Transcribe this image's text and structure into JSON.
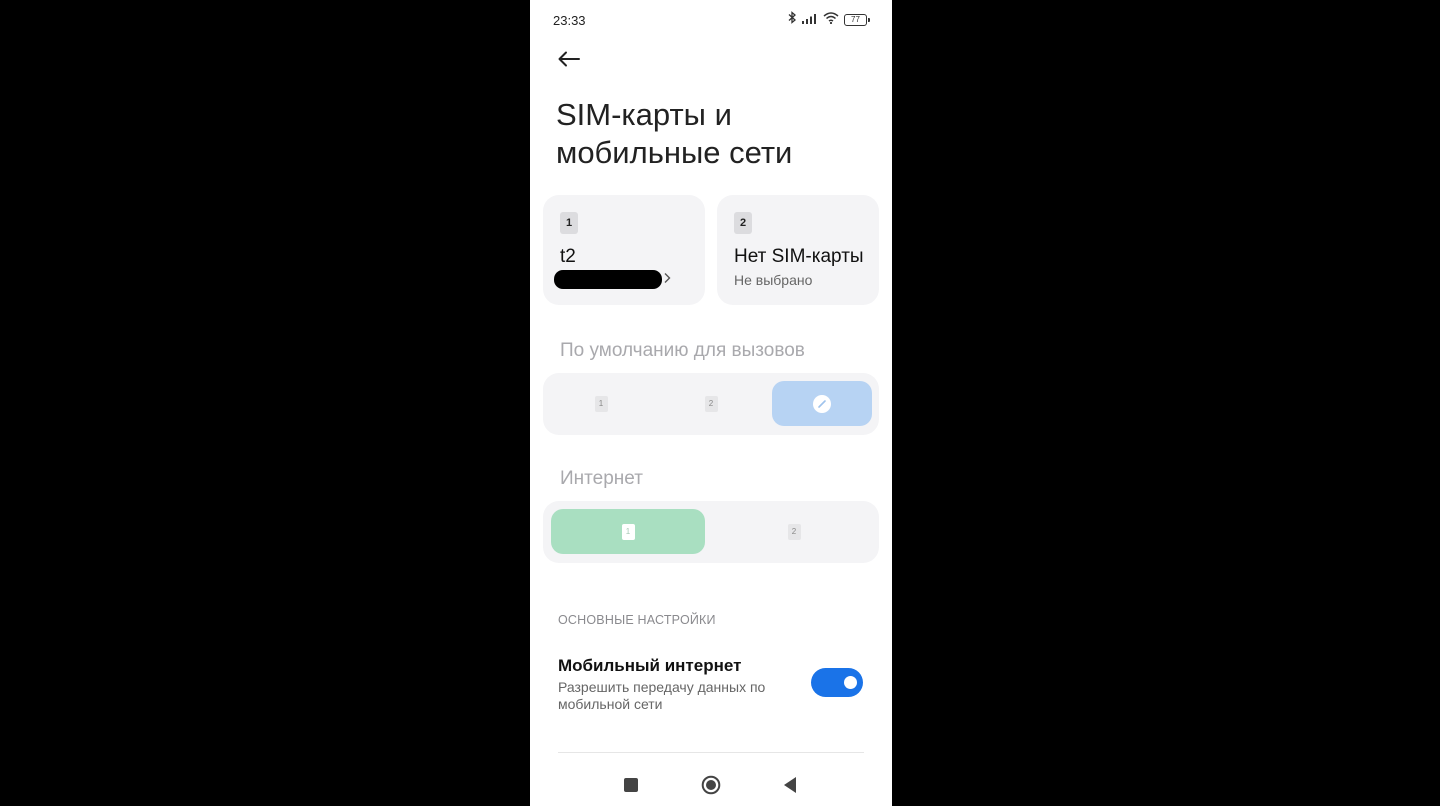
{
  "status_bar": {
    "time": "23:33",
    "battery": "77"
  },
  "header": {
    "title": "SIM-карты и мобильные сети"
  },
  "sim_cards": [
    {
      "slot": "1",
      "name": "t2",
      "subtitle": ""
    },
    {
      "slot": "2",
      "name": "Нет SIM-карты",
      "subtitle": "Не выбрано"
    }
  ],
  "calls": {
    "label": "По умолчанию для вызовов",
    "options": [
      {
        "slot": "1"
      },
      {
        "slot": "2"
      }
    ],
    "selected": "pencil-icon"
  },
  "internet": {
    "label": "Интернет",
    "options": [
      {
        "slot": "1"
      },
      {
        "slot": "2"
      }
    ],
    "selected_slot": "1"
  },
  "settings": {
    "group_header": "ОСНОВНЫЕ НАСТРОЙКИ",
    "mobile_data": {
      "title": "Мобильный интернет",
      "description": "Разрешить передачу данных по мобильной сети",
      "enabled": true
    }
  },
  "colors": {
    "accent": "#1a73e8",
    "calls_selected_bg": "#b7d3f3",
    "internet_selected_bg": "#a9dfc1",
    "card_bg": "#f4f4f6"
  },
  "icons": [
    "back-arrow-icon",
    "bluetooth-icon",
    "signal-icon",
    "wifi-icon",
    "battery-icon",
    "chevron-right-icon",
    "pencil-icon",
    "recents-square-icon",
    "home-circle-icon",
    "back-triangle-icon"
  ]
}
